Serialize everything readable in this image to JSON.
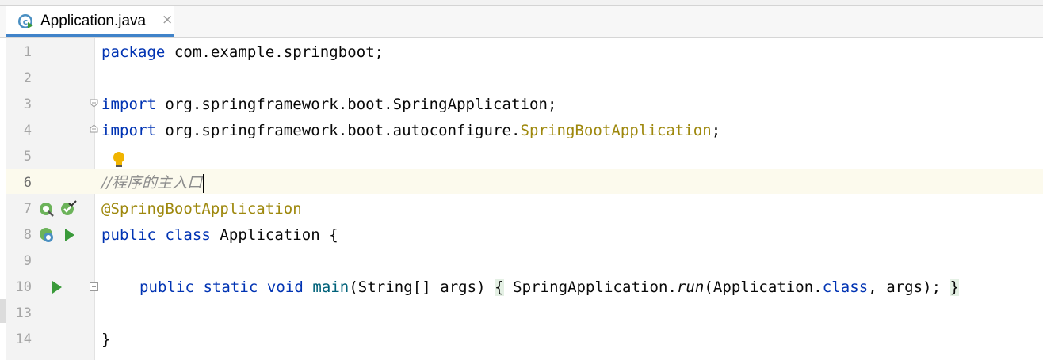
{
  "tab": {
    "label": "Application.java",
    "close": "×"
  },
  "lines": [
    {
      "n": "1"
    },
    {
      "n": "2"
    },
    {
      "n": "3"
    },
    {
      "n": "4"
    },
    {
      "n": "5"
    },
    {
      "n": "6"
    },
    {
      "n": "7"
    },
    {
      "n": "8"
    },
    {
      "n": "9"
    },
    {
      "n": "10"
    },
    {
      "n": "13"
    },
    {
      "n": "14"
    }
  ],
  "code": {
    "l1": {
      "kw": "package",
      "rest": " com.example.springboot;"
    },
    "l3": {
      "kw": "import",
      "rest": " org.springframework.boot.SpringApplication;"
    },
    "l4": {
      "kw": "import",
      "rest": " org.springframework.boot.autoconfigure.",
      "ann": "SpringBootApplication",
      "end": ";"
    },
    "l6": {
      "comment": "//程序的主入口"
    },
    "l7": {
      "ann": "@SpringBootApplication"
    },
    "l8": {
      "kw1": "public",
      "kw2": "class",
      "rest": " Application {"
    },
    "l10": {
      "kw1": "public",
      "kw2": "static",
      "kw3": "void",
      "fn": "main",
      "params": "(String[] args) ",
      "open": "{",
      "call1": " SpringApplication.",
      "call2": "run",
      "call3": "(Application.",
      "kw4": "class",
      "call4": ", args); ",
      "close": "}"
    },
    "l14": {
      "text": "}"
    }
  },
  "colors": {
    "keyword": "#0033b3",
    "annotation": "#9e880d",
    "comment": "#8c8c8c",
    "method": "#00627a",
    "tab_underline": "#4083c9",
    "run_green": "#3a9a3a"
  },
  "icons": [
    "java-class-icon",
    "bulb-icon",
    "spring-bean-icon",
    "run-icon",
    "fold-icon"
  ]
}
